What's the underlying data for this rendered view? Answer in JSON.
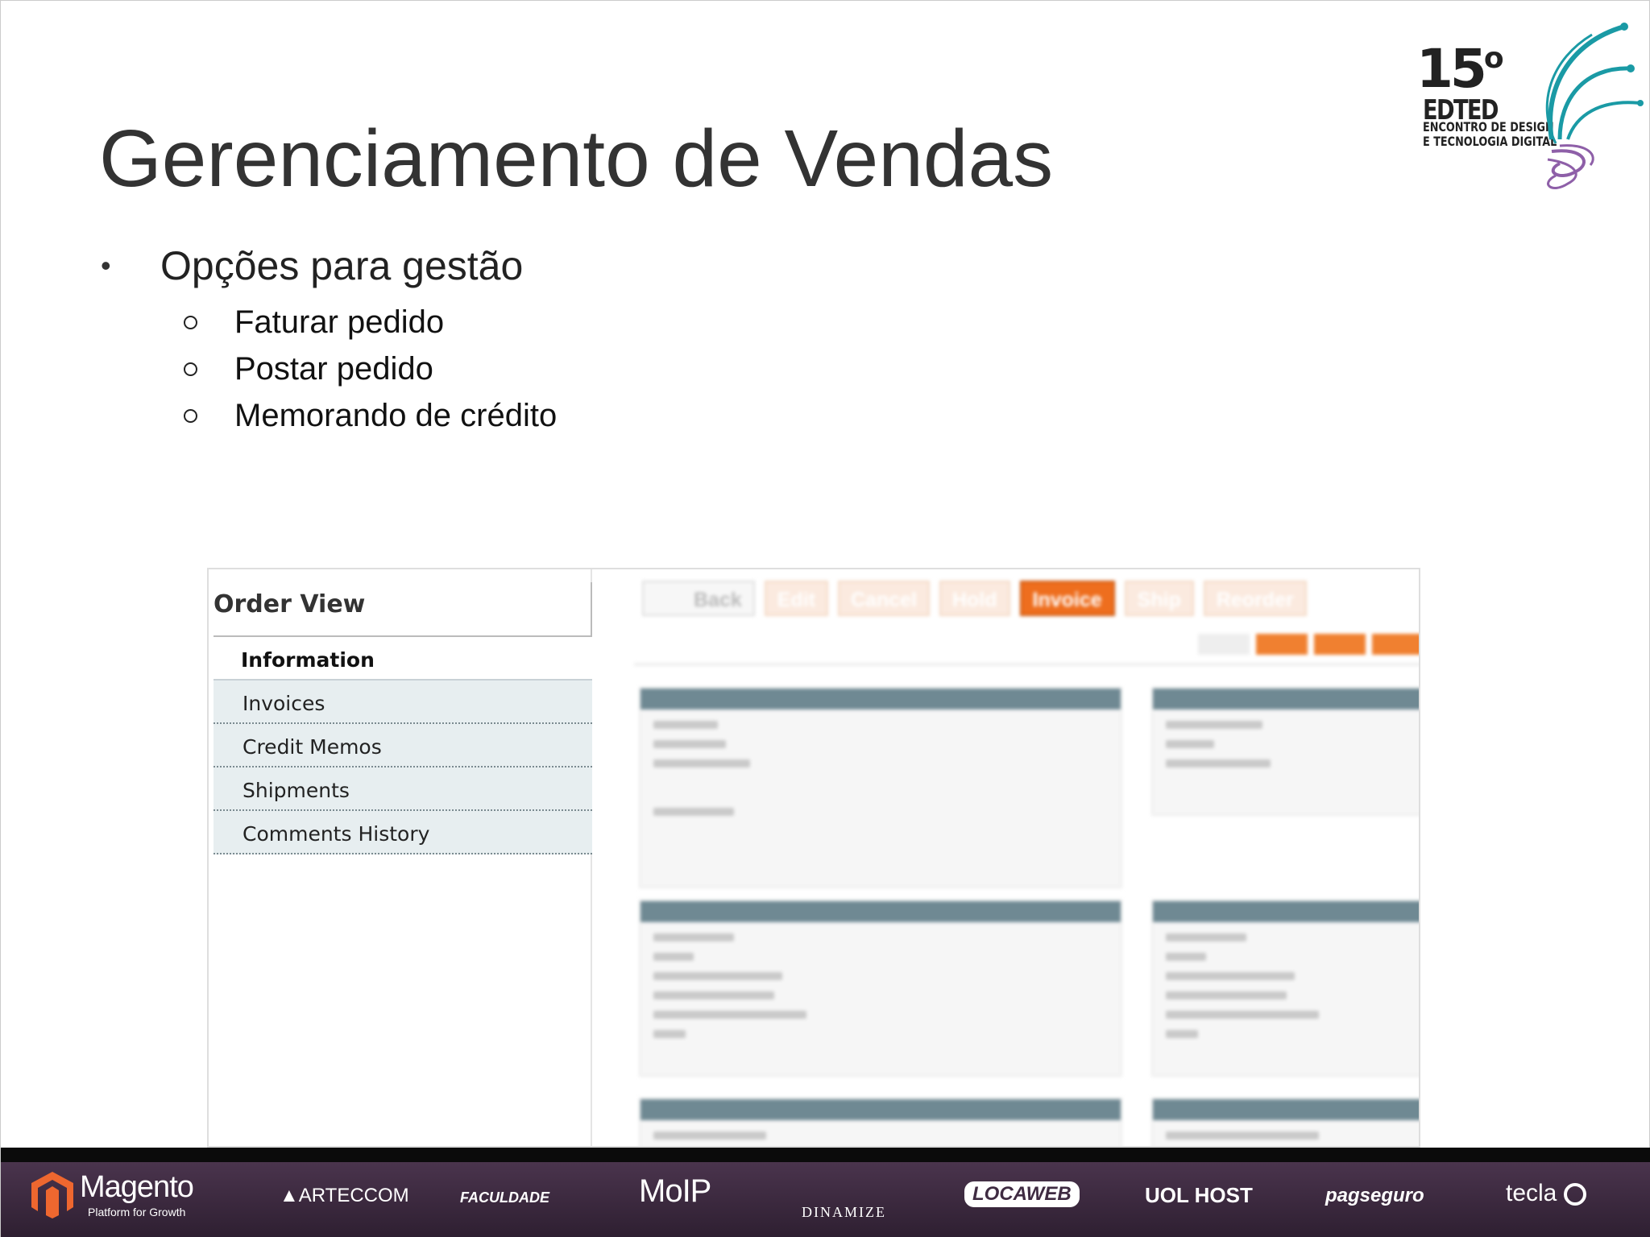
{
  "slide": {
    "title": "Gerenciamento de Vendas",
    "bullet": "Opções para gestão",
    "sub_items": [
      "Faturar pedido",
      "Postar pedido",
      "Memorando de crédito"
    ]
  },
  "logo": {
    "number": "15",
    "degree": "o",
    "name": "EDTED",
    "subtitle_line1": "ENCONTRO DE DESIGN",
    "subtitle_line2": "E TECNOLOGIA DIGITAL"
  },
  "order_view": {
    "title": "Order View",
    "tabs": [
      "Information",
      "Invoices",
      "Credit Memos",
      "Shipments",
      "Comments History"
    ],
    "active_tab": "Information",
    "buttons": [
      "Back",
      "Edit",
      "Cancel",
      "Hold",
      "Invoice",
      "Ship",
      "Reorder"
    ],
    "highlighted_button": "Invoice"
  },
  "footer_sponsors": [
    "Magento",
    "Platform for Growth",
    "ARTECCOM",
    "FACULDADE",
    "MoIP",
    "DINAMIZE",
    "LOCAWEB",
    "UOL HOST",
    "pagseguro",
    "tecla"
  ],
  "colors": {
    "footer_bg": "#3f2b42",
    "accent_orange": "#ee6e1e",
    "teal": "#1a9aa5",
    "purple": "#8e5fa8"
  }
}
